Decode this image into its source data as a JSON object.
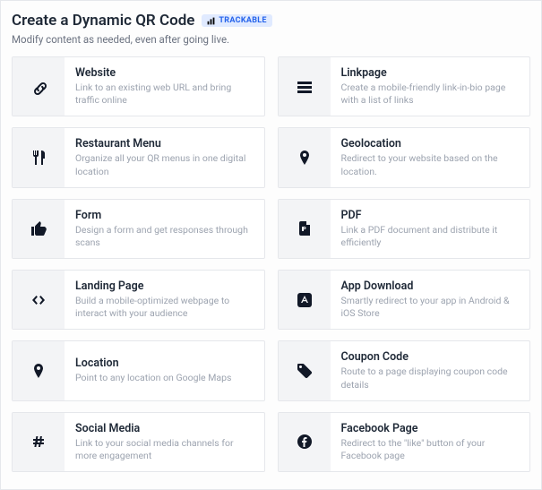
{
  "header": {
    "title": "Create a Dynamic QR Code",
    "badge": "TRACKABLE",
    "subtitle": "Modify content as needed, even after going live."
  },
  "items": [
    {
      "icon": "link-icon",
      "title": "Website",
      "desc": "Link to an existing web URL and bring traffic online"
    },
    {
      "icon": "menu-icon",
      "title": "Linkpage",
      "desc": "Create a mobile-friendly link-in-bio page with a list of links"
    },
    {
      "icon": "utensils-icon",
      "title": "Restaurant Menu",
      "desc": "Organize all your QR menus in one digital location"
    },
    {
      "icon": "pin-icon",
      "title": "Geolocation",
      "desc": "Redirect to your website based on the location."
    },
    {
      "icon": "thumbsup-icon",
      "title": "Form",
      "desc": "Design a form and get responses through scans"
    },
    {
      "icon": "pdf-icon",
      "title": "PDF",
      "desc": "Link a PDF document and distribute it efficiently"
    },
    {
      "icon": "code-icon",
      "title": "Landing Page",
      "desc": "Build a mobile-optimized webpage to interact with your audience"
    },
    {
      "icon": "app-icon",
      "title": "App Download",
      "desc": "Smartly redirect to your app in Android & iOS Store"
    },
    {
      "icon": "pin-icon",
      "title": "Location",
      "desc": "Point to any location on Google Maps"
    },
    {
      "icon": "tag-icon",
      "title": "Coupon Code",
      "desc": "Route to a page displaying coupon code details"
    },
    {
      "icon": "hash-icon",
      "title": "Social Media",
      "desc": "Link to your social media channels for more engagement"
    },
    {
      "icon": "facebook-icon",
      "title": "Facebook Page",
      "desc": "Redirect to the \"like\" button of your Facebook page"
    }
  ]
}
